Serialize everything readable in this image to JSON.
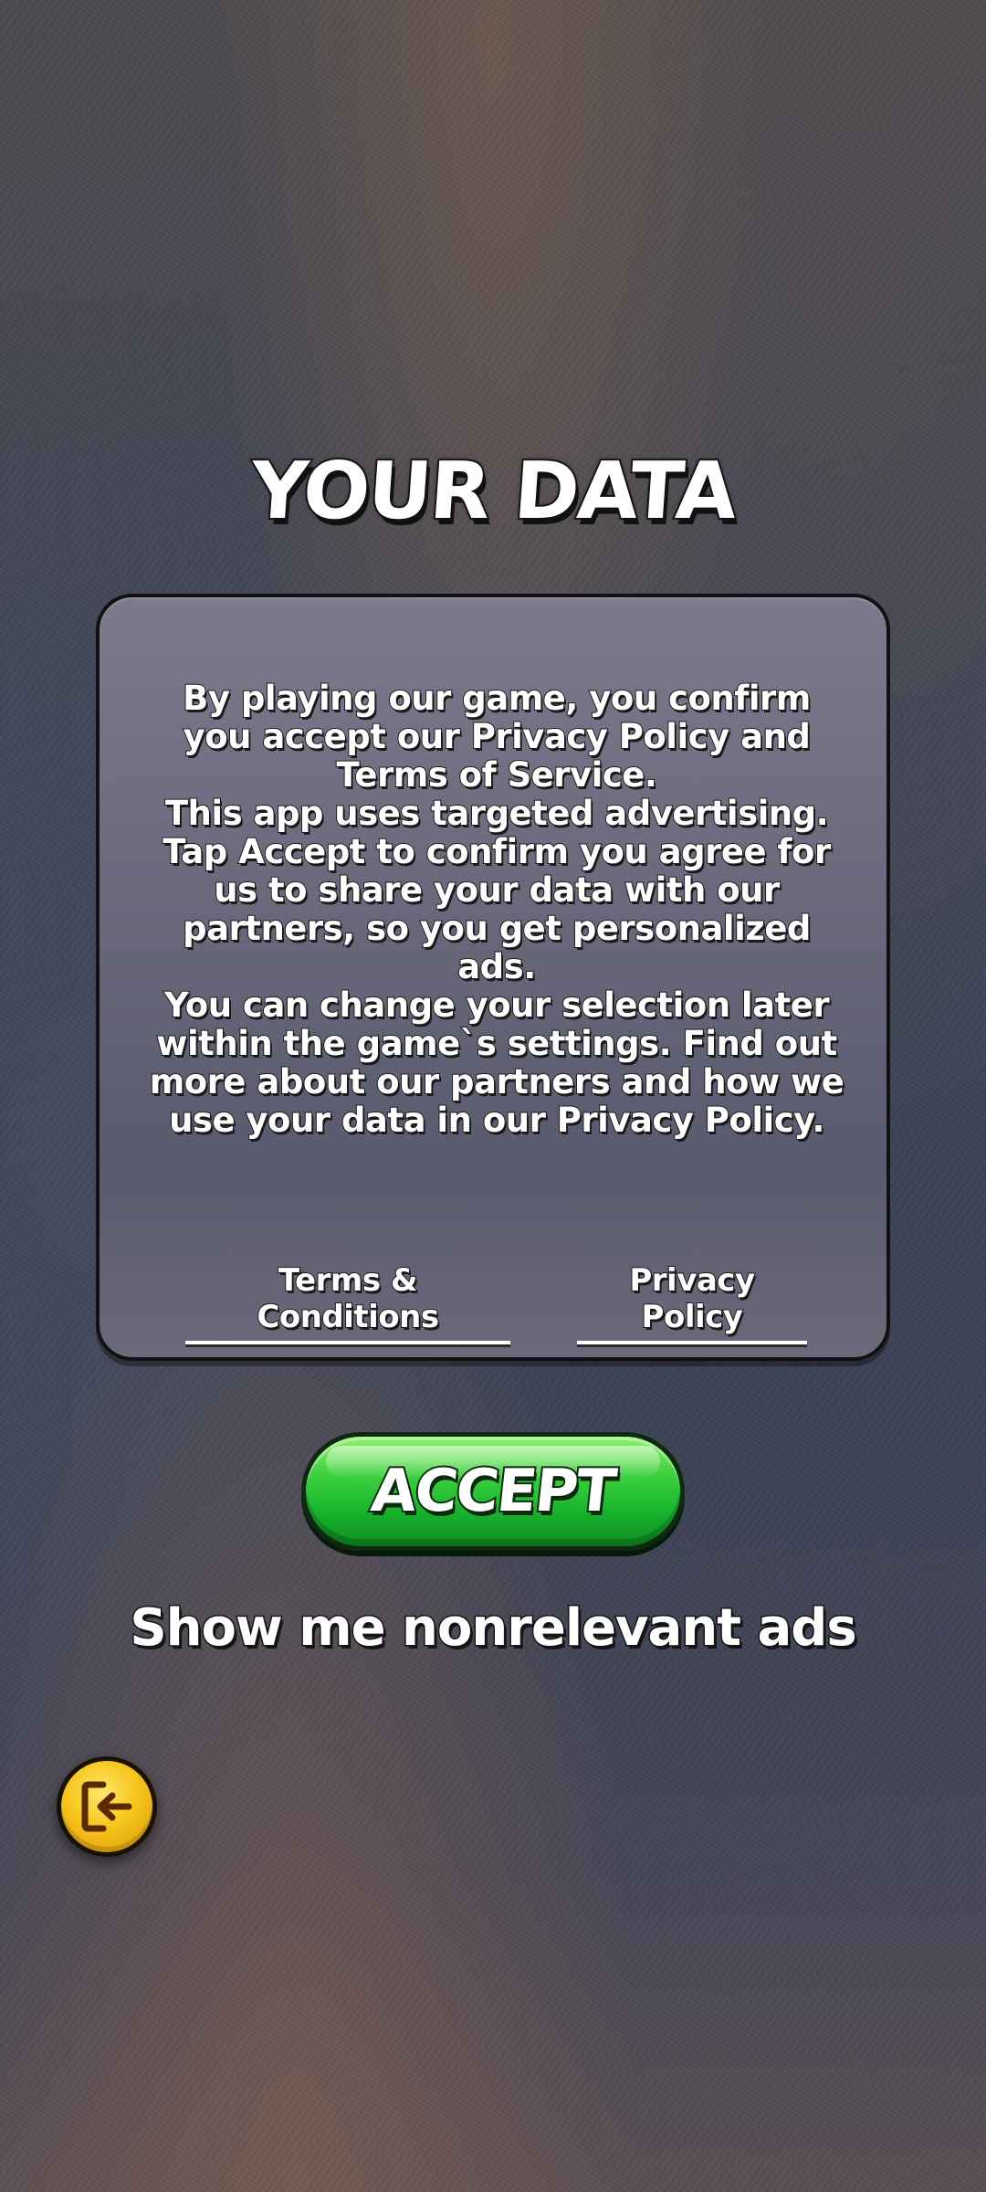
{
  "title": "YOUR DATA",
  "panel": {
    "paragraphs": [
      "By playing our game, you confirm you accept our Privacy Policy and Terms of Service.",
      "This app uses targeted advertising. Tap Accept to confirm you agree for us to share your data with our partners, so you get personalized ads.",
      "You can change your selection later within the game`s settings. Find out more about our partners and how we use your data in our Privacy Policy."
    ],
    "terms_link": "Terms & Conditions",
    "privacy_link": "Privacy Policy"
  },
  "accept_button": {
    "label": "ACCEPT"
  },
  "nonrelevant_link": "Show me nonrelevant ads",
  "exit_button": {
    "icon": "exit-icon"
  },
  "colors": {
    "accept_green": "#17b22c",
    "exit_yellow": "#f7c51b",
    "panel": "#6a697c"
  }
}
